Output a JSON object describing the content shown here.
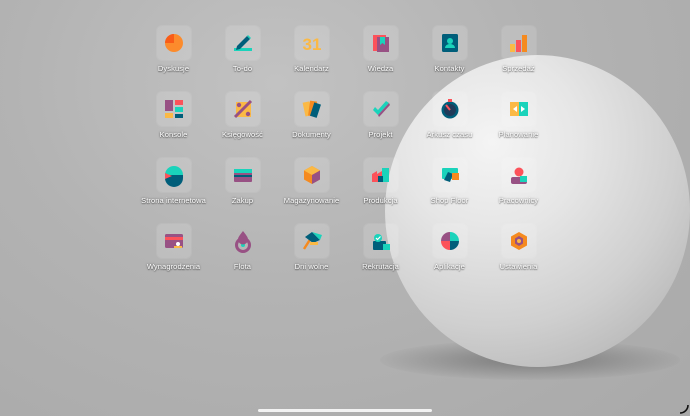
{
  "apps": [
    {
      "label": "Dyskusje",
      "icon": "discuss-icon",
      "name": "app-dyskusje"
    },
    {
      "label": "To-do",
      "icon": "todo-icon",
      "name": "app-to-do"
    },
    {
      "label": "Kalendarz",
      "icon": "calendar-icon",
      "name": "app-kalendarz",
      "icon_text": "31"
    },
    {
      "label": "Wiedza",
      "icon": "knowledge-icon",
      "name": "app-wiedza"
    },
    {
      "label": "Kontakty",
      "icon": "contacts-icon",
      "name": "app-kontakty"
    },
    {
      "label": "Sprzedaż",
      "icon": "sales-icon",
      "name": "app-sprzedaz"
    },
    {
      "label": "Konsole",
      "icon": "dashboard-icon",
      "name": "app-konsole"
    },
    {
      "label": "Księgowość",
      "icon": "accounting-icon",
      "name": "app-ksiegowosc"
    },
    {
      "label": "Dokumenty",
      "icon": "documents-icon",
      "name": "app-dokumenty"
    },
    {
      "label": "Projekt",
      "icon": "project-icon",
      "name": "app-projekt"
    },
    {
      "label": "Arkusz czasu",
      "icon": "timesheet-icon",
      "name": "app-arkusz-czasu"
    },
    {
      "label": "Planowanie",
      "icon": "planning-icon",
      "name": "app-planowanie"
    },
    {
      "label": "Strona internetowa",
      "icon": "website-icon",
      "name": "app-strona-internetowa"
    },
    {
      "label": "Zakup",
      "icon": "purchase-icon",
      "name": "app-zakup"
    },
    {
      "label": "Magazynowanie",
      "icon": "inventory-icon",
      "name": "app-magazynowanie"
    },
    {
      "label": "Produkcja",
      "icon": "manufacturing-icon",
      "name": "app-produkcja"
    },
    {
      "label": "Shop Floor",
      "icon": "shop-floor-icon",
      "name": "app-shop-floor"
    },
    {
      "label": "Pracownicy",
      "icon": "employees-icon",
      "name": "app-pracownicy"
    },
    {
      "label": "Wynagrodzenia",
      "icon": "payroll-icon",
      "name": "app-wynagrodzenia"
    },
    {
      "label": "Flota",
      "icon": "fleet-icon",
      "name": "app-flota"
    },
    {
      "label": "Dni wolne",
      "icon": "time-off-icon",
      "name": "app-dni-wolne"
    },
    {
      "label": "Rekrutacja",
      "icon": "recruitment-icon",
      "name": "app-rekrutacja"
    },
    {
      "label": "Aplikacje",
      "icon": "apps-icon",
      "name": "app-aplikacje"
    },
    {
      "label": "Ustawienia",
      "icon": "settings-icon",
      "name": "app-ustawienia"
    }
  ],
  "colors": {
    "orange": "#f58a1f",
    "purple": "#985184",
    "teal": "#1ad3bb",
    "dark_teal": "#005e7a",
    "red": "#fc525a",
    "yellow": "#fbb945"
  }
}
